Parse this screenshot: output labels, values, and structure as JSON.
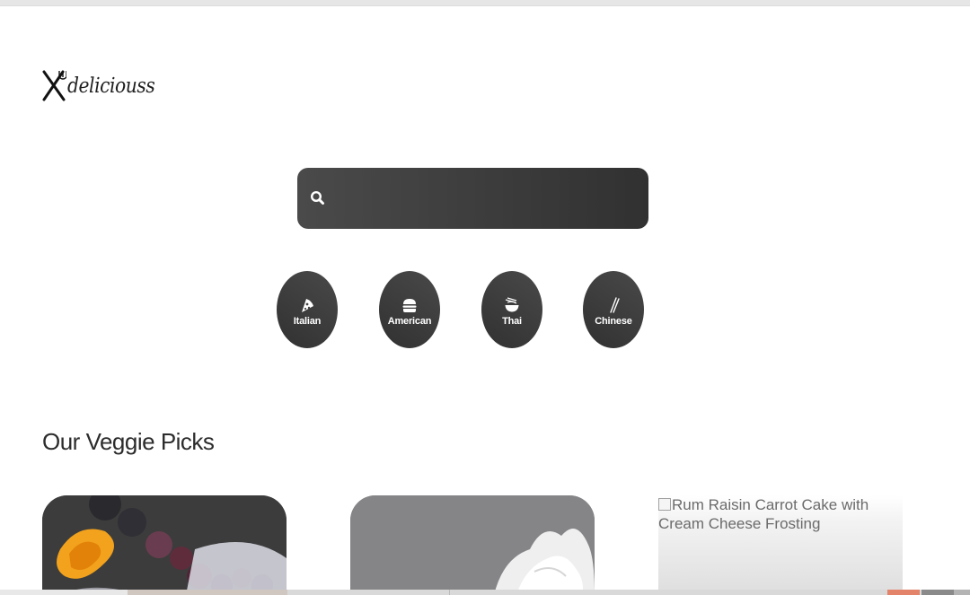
{
  "brand": {
    "logo_text": "deliciouss",
    "logo_icon": "fork-knife-icon"
  },
  "search": {
    "value": "",
    "placeholder": "",
    "icon": "search-icon"
  },
  "cuisines": [
    {
      "label": "Italian",
      "icon": "pizza-icon"
    },
    {
      "label": "American",
      "icon": "burger-icon"
    },
    {
      "label": "Thai",
      "icon": "noodle-bowl-icon"
    },
    {
      "label": "Chinese",
      "icon": "chopsticks-icon"
    }
  ],
  "veggie": {
    "title": "Our Veggie Picks",
    "cards": [
      {
        "image": "dessert-with-berries-photo"
      },
      {
        "image": "cream-dessert-photo"
      },
      {
        "alt": "Rum Raisin Carrot Cake with Cream Cheese Frosting"
      }
    ]
  },
  "colors": {
    "primary_dark": "#313131",
    "accent": "#494949",
    "text": "#2c2c2c"
  }
}
